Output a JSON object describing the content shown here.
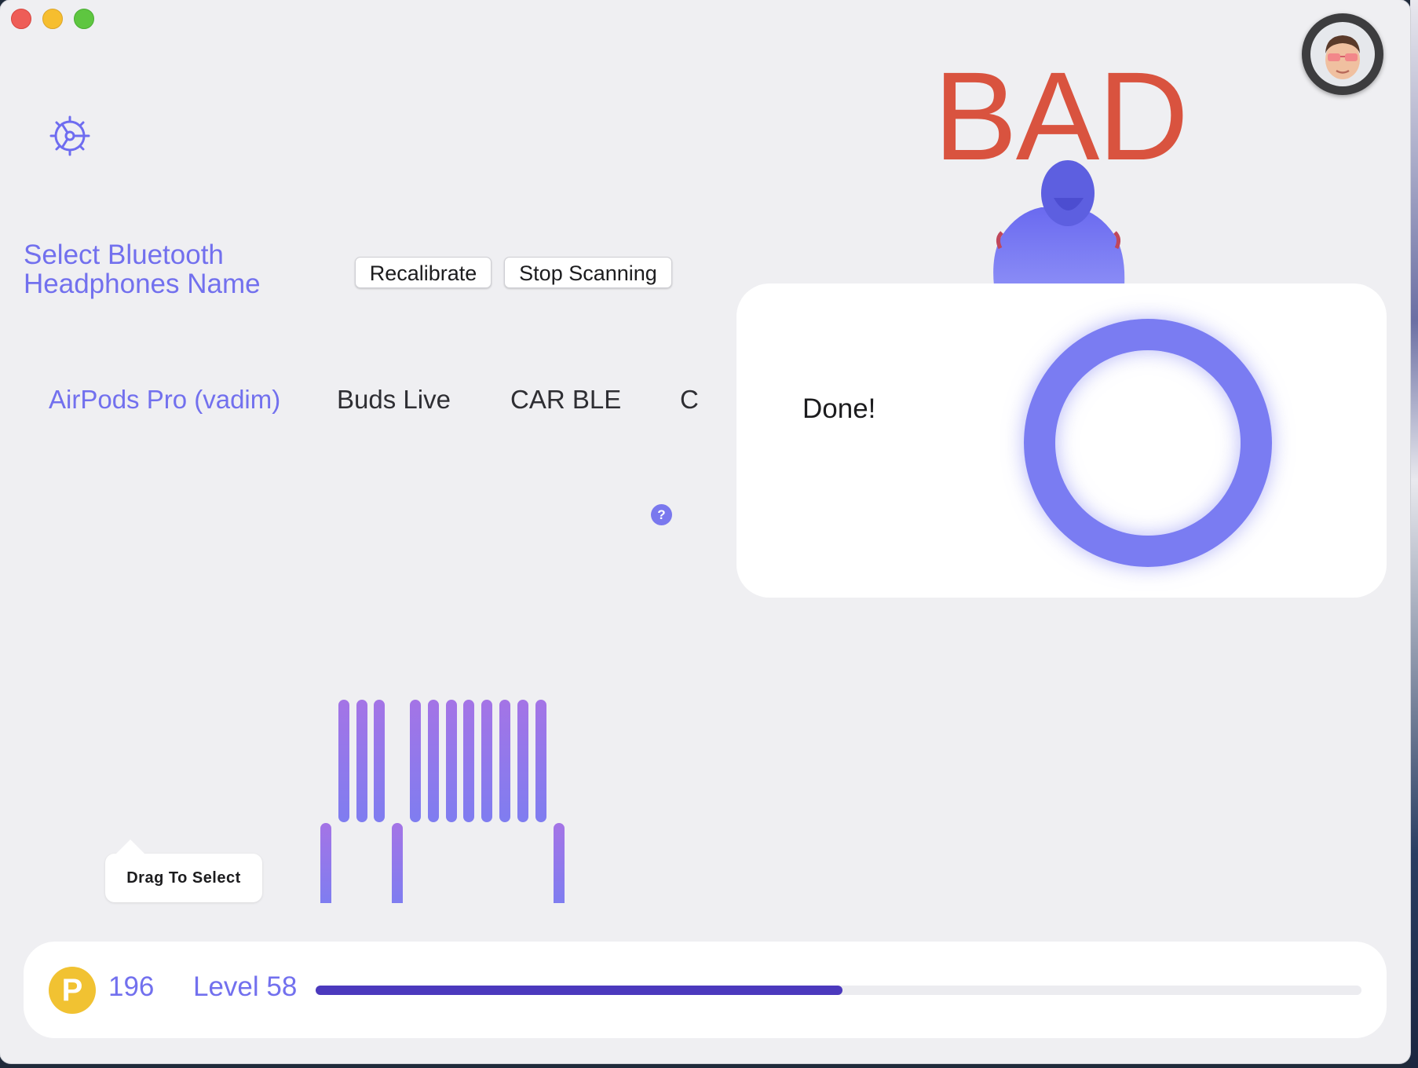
{
  "header": {
    "select_title_line1": "Select Bluetooth",
    "select_title_line2": "Headphones Name",
    "recalibrate_label": "Recalibrate",
    "stop_scanning_label": "Stop Scanning"
  },
  "devices": [
    {
      "label": "AirPods Pro (vadim)",
      "selected": true
    },
    {
      "label": "Buds Live",
      "selected": false
    },
    {
      "label": "CAR BLE",
      "selected": false
    },
    {
      "label": "C",
      "selected": false
    }
  ],
  "help": {
    "label": "?"
  },
  "posture": {
    "status": "BAD",
    "status_color": "#d9533f"
  },
  "calibration_card": {
    "message": "Done!",
    "ring_color": "#7a7cf2"
  },
  "tooltip": {
    "label": "Drag To Select"
  },
  "signal_bars": {
    "upper": [
      1,
      1,
      1,
      0,
      1,
      1,
      1,
      1,
      1,
      1,
      1
    ],
    "lower": [
      1,
      0,
      0,
      1,
      0,
      0,
      0,
      0,
      0,
      0,
      0,
      0,
      0,
      1
    ]
  },
  "footer": {
    "coin_letter": "P",
    "points": "196",
    "level_label": "Level 58",
    "progress": 0.504
  },
  "colors": {
    "accent": "#7270ee",
    "progress": "#4b39bd",
    "coin": "#f1c232"
  },
  "icons": {
    "settings": "gear-icon",
    "avatar": "memoji-avatar",
    "figure": "posture-figure"
  }
}
